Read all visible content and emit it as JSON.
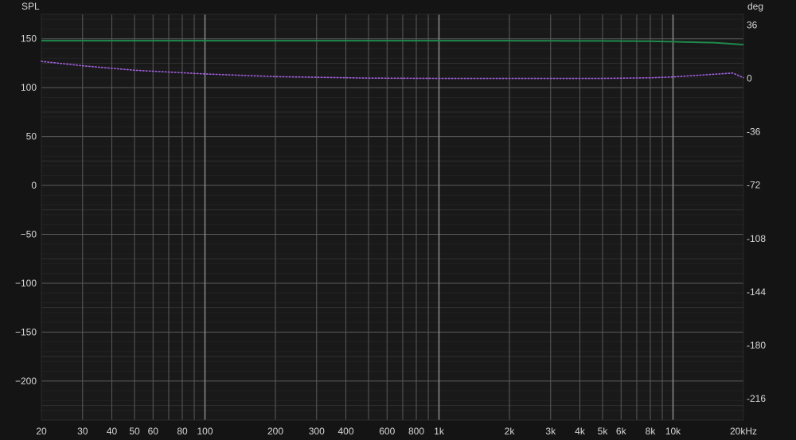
{
  "chart_data": {
    "type": "line",
    "title": "",
    "xlabel": "",
    "ylabel": "SPL",
    "y2label": "deg",
    "x_scale": "log",
    "xlim": [
      20,
      20000
    ],
    "ylim": [
      -240,
      175
    ],
    "y2lim": [
      -230.4,
      43.2
    ],
    "grid": true,
    "legend": "none",
    "x_ticks": [
      {
        "value": 20,
        "label": "20"
      },
      {
        "value": 30,
        "label": "30"
      },
      {
        "value": 40,
        "label": "40"
      },
      {
        "value": 50,
        "label": "50"
      },
      {
        "value": 60,
        "label": "60"
      },
      {
        "value": 80,
        "label": "80"
      },
      {
        "value": 100,
        "label": "100"
      },
      {
        "value": 200,
        "label": "200"
      },
      {
        "value": 300,
        "label": "300"
      },
      {
        "value": 400,
        "label": "400"
      },
      {
        "value": 600,
        "label": "600"
      },
      {
        "value": 800,
        "label": "800"
      },
      {
        "value": 1000,
        "label": "1k"
      },
      {
        "value": 2000,
        "label": "2k"
      },
      {
        "value": 3000,
        "label": "3k"
      },
      {
        "value": 4000,
        "label": "4k"
      },
      {
        "value": 5000,
        "label": "5k"
      },
      {
        "value": 6000,
        "label": "6k"
      },
      {
        "value": 8000,
        "label": "8k"
      },
      {
        "value": 10000,
        "label": "10k"
      },
      {
        "value": 20000,
        "label": "20kHz"
      }
    ],
    "y_ticks": [
      {
        "value": 150,
        "label": "150"
      },
      {
        "value": 100,
        "label": "100"
      },
      {
        "value": 50,
        "label": "50"
      },
      {
        "value": 0,
        "label": "0"
      },
      {
        "value": -50,
        "label": "−50"
      },
      {
        "value": -100,
        "label": "−100"
      },
      {
        "value": -150,
        "label": "−150"
      },
      {
        "value": -200,
        "label": "−200"
      }
    ],
    "y2_ticks": [
      {
        "value": 36,
        "label": "36"
      },
      {
        "value": 0,
        "label": "0"
      },
      {
        "value": -36,
        "label": "-36"
      },
      {
        "value": -72,
        "label": "-72"
      },
      {
        "value": -108,
        "label": "-108"
      },
      {
        "value": -144,
        "label": "-144"
      },
      {
        "value": -180,
        "label": "-180"
      },
      {
        "value": -216,
        "label": "-216"
      }
    ],
    "series": [
      {
        "axis": "left",
        "style": "solid",
        "color": "#1f8a4c",
        "x": [
          20,
          50,
          100,
          200,
          500,
          1000,
          2000,
          5000,
          8000,
          10000,
          15000,
          20000
        ],
        "y": [
          148,
          148,
          148,
          148,
          148,
          148,
          148,
          147.8,
          147.5,
          147,
          146,
          144
        ]
      },
      {
        "axis": "right",
        "style": "dotted",
        "color": "#a35fe0",
        "x": [
          20,
          30,
          50,
          100,
          200,
          500,
          1000,
          2000,
          5000,
          8000,
          10000,
          15000,
          18000,
          20000
        ],
        "y": [
          11.5,
          8.5,
          5.5,
          3.0,
          1.2,
          0.2,
          0,
          0,
          0,
          0.4,
          1.0,
          2.8,
          3.6,
          0.5
        ]
      }
    ],
    "colors": {
      "background": "#141414",
      "plot_background": "#191919",
      "major_grid": "#5a5a5a",
      "minor_grid": "#303030",
      "fine_grid": "#222222",
      "decade_grid": "#8a8a8a",
      "text": "#d6d6d6"
    }
  }
}
